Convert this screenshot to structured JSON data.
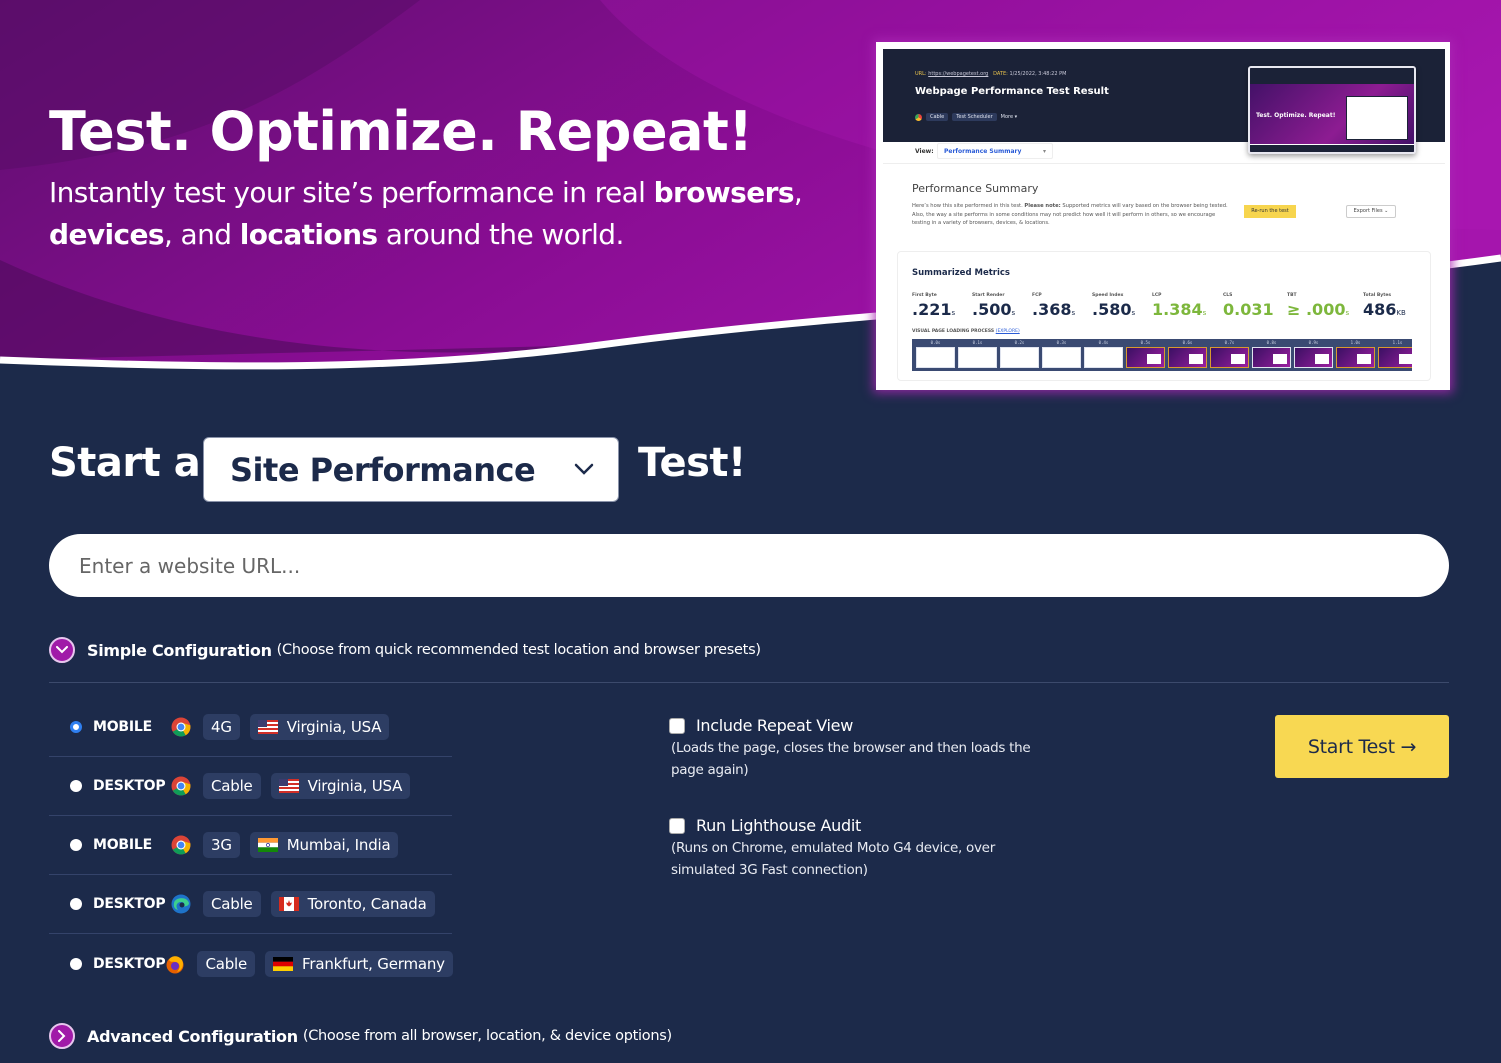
{
  "hero": {
    "title": "Test. Optimize. Repeat!",
    "subtitle_parts": [
      "Instantly test your site’s performance in real ",
      "browsers",
      ",",
      "devices",
      ", and ",
      "locations",
      " around the world."
    ]
  },
  "preview": {
    "url_label": "URL:",
    "url": "https://webpagetest.org",
    "date_label": "DATE:",
    "date": "1/25/2022, 3:48:22 PM",
    "title": "Webpage Performance Test Result",
    "chips": [
      "Cable",
      "Test Scheduler",
      "More ▾"
    ],
    "thumb_text": "Test. Optimize. Repeat!",
    "view_label": "View:",
    "view_value": "Performance Summary",
    "summary_title": "Performance Summary",
    "summary_desc_pre": "Here’s how this site performed in this test. ",
    "summary_desc_bold": "Please note:",
    "summary_desc_post": " Supported metrics will vary based on the browser being tested. Also, the way a site performs in some conditions may not predict how well it will perform in others, so we encourage testing in a variety of browsers, devices, & locations.",
    "rerun_label": "Re-run the test",
    "export_label": "Export Files ⌄",
    "metrics_title": "Summarized Metrics",
    "metrics": [
      {
        "label": "First Byte",
        "value": ".221",
        "unit": "s",
        "good": false
      },
      {
        "label": "Start Render",
        "value": ".500",
        "unit": "s",
        "good": false
      },
      {
        "label": "FCP",
        "value": ".368",
        "unit": "s",
        "good": false
      },
      {
        "label": "Speed Index",
        "value": ".580",
        "unit": "s",
        "good": false
      },
      {
        "label": "LCP",
        "value": "1.384",
        "unit": "s",
        "good": true
      },
      {
        "label": "CLS",
        "value": "0.031",
        "unit": "",
        "good": true
      },
      {
        "label": "TBT",
        "value": "≥ .000",
        "unit": "s",
        "good": true
      },
      {
        "label": "Total Bytes",
        "value": "486",
        "unit": "KB",
        "good": false
      }
    ],
    "vplp_label": "VISUAL PAGE LOADING PROCESS",
    "explore_label": "(EXPLORE)",
    "frames": [
      "0.0s",
      "0.1s",
      "0.2s",
      "0.3s",
      "0.4s",
      "0.5s",
      "0.6s",
      "0.7s",
      "0.8s",
      "0.9s",
      "1.0s",
      "1.1s"
    ]
  },
  "start": {
    "prefix": "Start a",
    "test_type": "Site Performance",
    "suffix": "Test!",
    "url_placeholder": "Enter a website URL...",
    "url_value": ""
  },
  "simple_config": {
    "title": "Simple Configuration",
    "desc": "(Choose from quick recommended test location and browser presets)"
  },
  "presets": [
    {
      "device": "MOBILE",
      "browser": "chrome",
      "connection": "4G",
      "flag": "us",
      "location": "Virginia, USA",
      "selected": true
    },
    {
      "device": "DESKTOP",
      "browser": "chrome",
      "connection": "Cable",
      "flag": "us",
      "location": "Virginia, USA",
      "selected": false
    },
    {
      "device": "MOBILE",
      "browser": "chrome",
      "connection": "3G",
      "flag": "in",
      "location": "Mumbai, India",
      "selected": false
    },
    {
      "device": "DESKTOP",
      "browser": "edge",
      "connection": "Cable",
      "flag": "ca",
      "location": "Toronto, Canada",
      "selected": false
    },
    {
      "device": "DESKTOP",
      "browser": "firefox",
      "connection": "Cable",
      "flag": "de",
      "location": "Frankfurt, Germany",
      "selected": false
    }
  ],
  "options": {
    "repeat_view": {
      "label": "Include Repeat View",
      "desc": "(Loads the page, closes the browser and then loads the page again)",
      "checked": false
    },
    "lighthouse": {
      "label": "Run Lighthouse Audit",
      "desc": "(Runs on Chrome, emulated Moto G4 device, over simulated 3G Fast connection)",
      "checked": false
    }
  },
  "start_button": "Start Test →",
  "advanced_config": {
    "title": "Advanced Configuration",
    "desc": "(Choose from all browser, location, & device options)"
  },
  "colors": {
    "navy": "#1c2a4a",
    "purple": "#a01aa8",
    "yellow": "#f8d852",
    "radio_blue": "#2f7ff0",
    "metric_green": "#7db73c"
  }
}
